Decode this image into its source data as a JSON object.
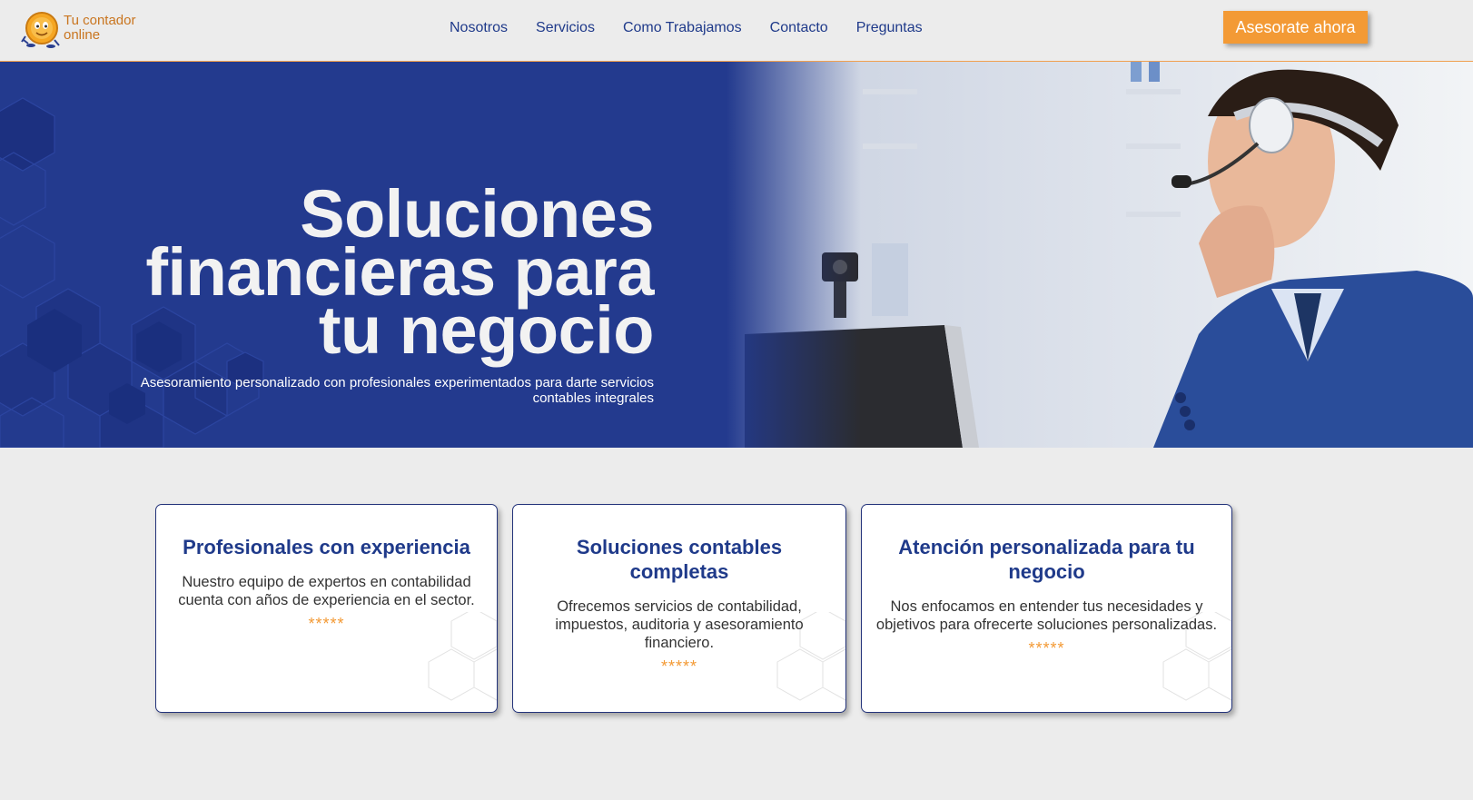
{
  "header": {
    "logo_line1": "Tu contador",
    "logo_line2": "online",
    "nav": [
      "Nosotros",
      "Servicios",
      "Como Trabajamos",
      "Contacto",
      "Preguntas"
    ],
    "cta_label": "Asesorate ahora"
  },
  "hero": {
    "title_line1": "Soluciones",
    "title_line2": "financieras para",
    "title_line3": "tu negocio",
    "subtitle": "Asesoramiento personalizado con profesionales experimentados para darte servicios contables integrales"
  },
  "cards": [
    {
      "title": "Profesionales con experiencia",
      "text": "Nuestro equipo de expertos en contabilidad cuenta con años de experiencia en el sector.",
      "stars": "*****"
    },
    {
      "title": "Soluciones contables completas",
      "text": "Ofrecemos servicios de contabilidad, impuestos, auditoria y asesoramiento financiero.",
      "stars": "*****"
    },
    {
      "title": "Atención personalizada para tu negocio",
      "text": "Nos enfocamos en entender tus necesidades y objetivos para ofrecerte soluciones personalizadas.",
      "stars": "*****"
    }
  ],
  "colors": {
    "brand_blue": "#233a8e",
    "accent_orange": "#f39a35",
    "nav_text": "#1f3a8a"
  },
  "icons": [
    "coin-mascot-logo-icon",
    "hexagon-pattern-icon"
  ]
}
